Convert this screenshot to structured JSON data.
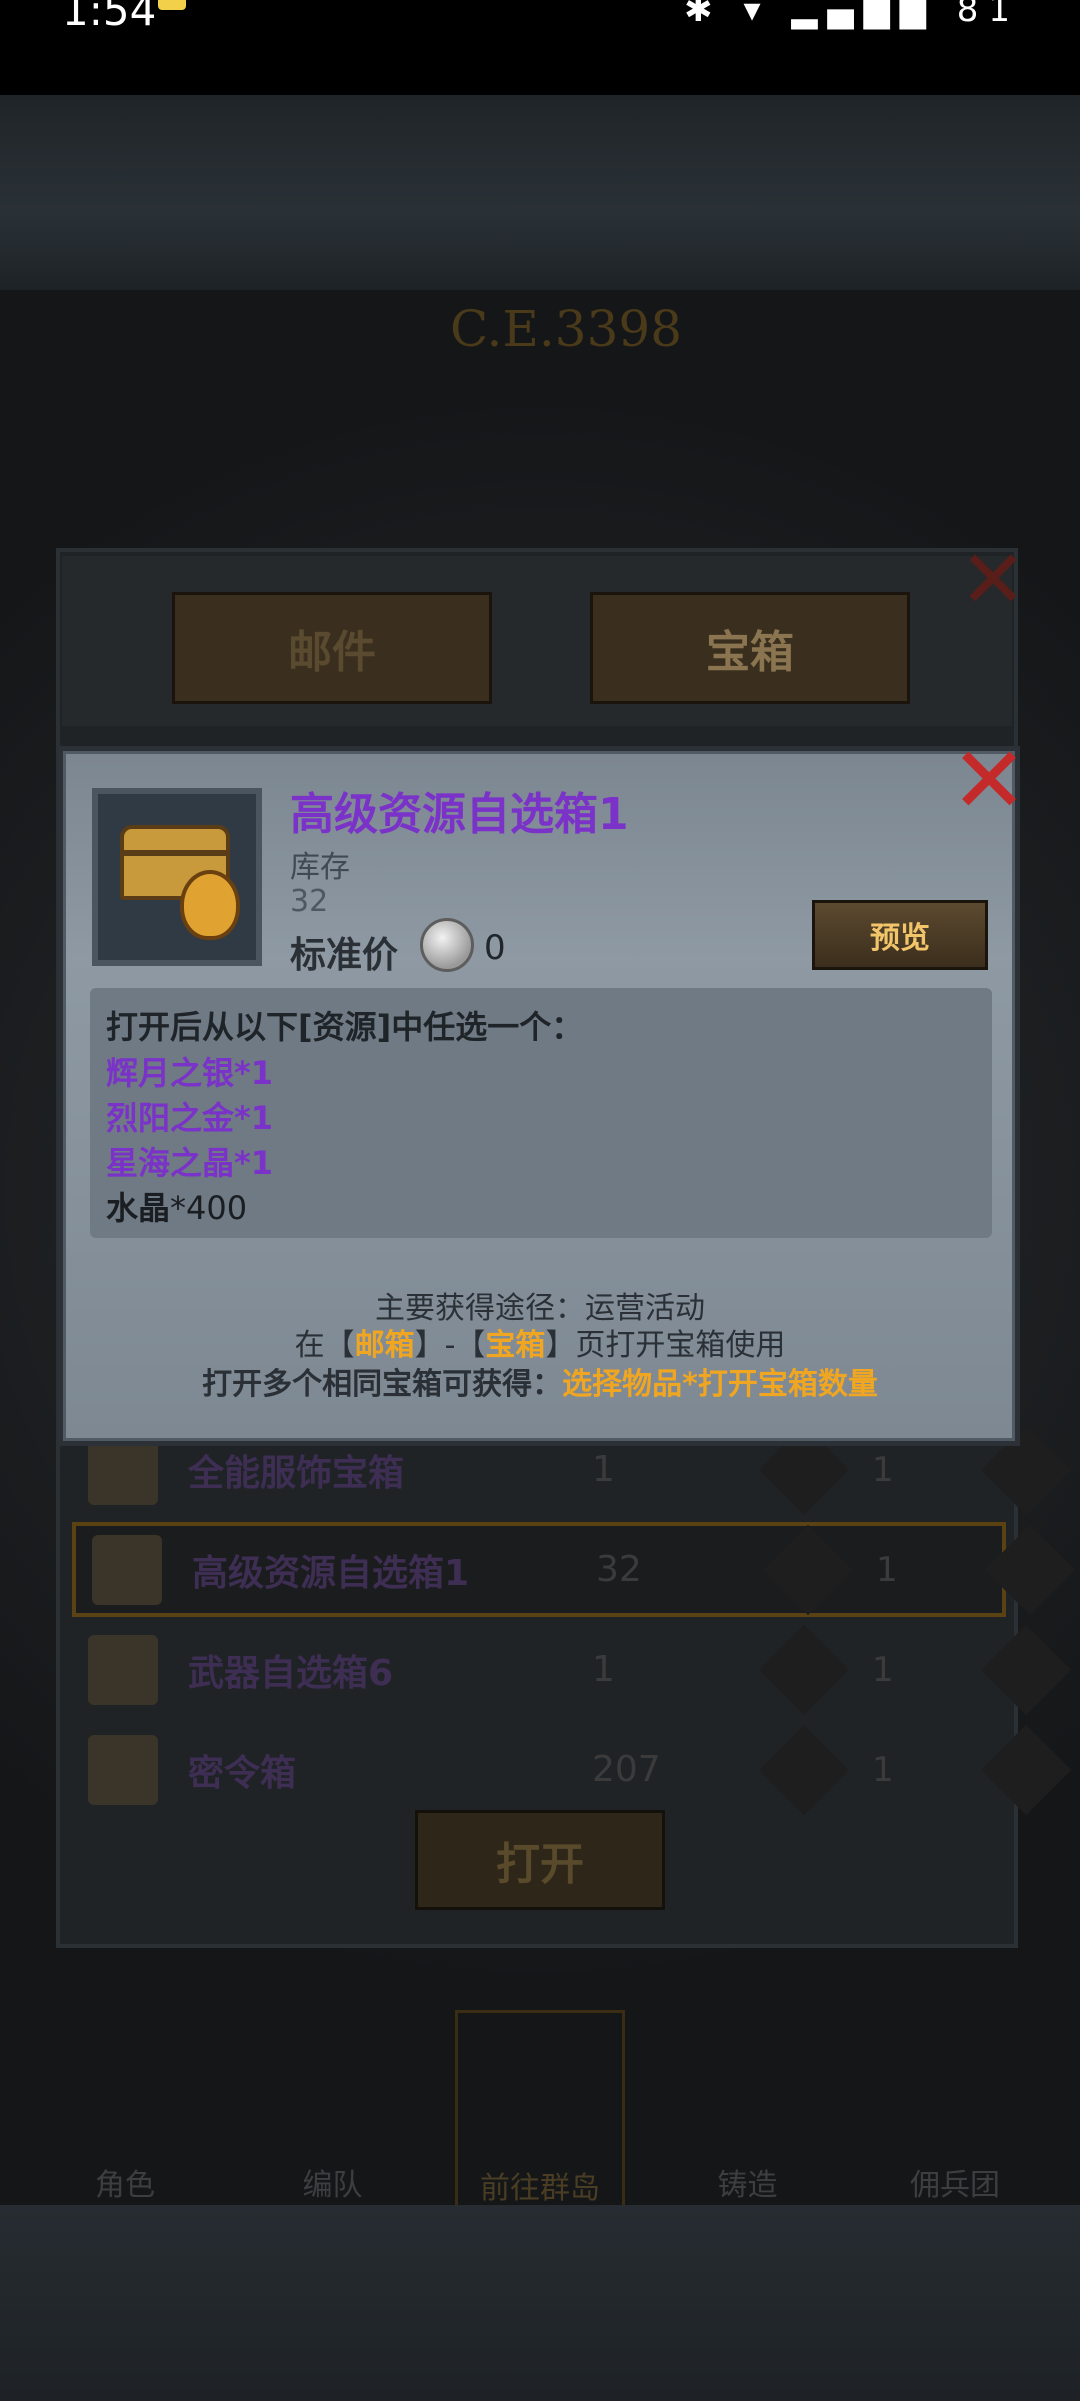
{
  "status_bar": {
    "time": "1:54",
    "icons_text": "✱ ▾ ▂▄▆█ 81"
  },
  "game": {
    "header_ghost": "C.E.3398",
    "nav": [
      "角色",
      "编队",
      "前往群岛",
      "铸造",
      "佣兵团"
    ]
  },
  "tabs": {
    "mail": "邮件",
    "chest": "宝箱"
  },
  "list": [
    {
      "name": "全能服饰宝箱",
      "count": "1",
      "qty": "1"
    },
    {
      "name": "高级资源自选箱1",
      "count": "32",
      "qty": "1"
    },
    {
      "name": "武器自选箱6",
      "count": "1",
      "qty": "1"
    },
    {
      "name": "密令箱",
      "count": "207",
      "qty": "1"
    }
  ],
  "open_button": "打开",
  "detail": {
    "title": "高级资源自选箱1",
    "stock_label": "库存",
    "stock_value": "32",
    "price_label": "标准价",
    "price_value": "0",
    "preview_button": "预览",
    "desc_intro": "打开后从以下[资源]中任选一个：",
    "options": [
      "辉月之银*1",
      "烈阳之金*1",
      "星海之晶*1"
    ],
    "crystal_name": "水晶",
    "crystal_amount": "*400",
    "source_line": "主要获得途径：运营活动",
    "usage_prefix": "在【",
    "usage_mail": "邮箱",
    "usage_mid": "】-【",
    "usage_chest": "宝箱",
    "usage_suffix": "】页打开宝箱使用",
    "multi_prefix": "打开多个相同宝箱可获得：",
    "multi_highlight": "选择物品*打开宝箱数量"
  }
}
